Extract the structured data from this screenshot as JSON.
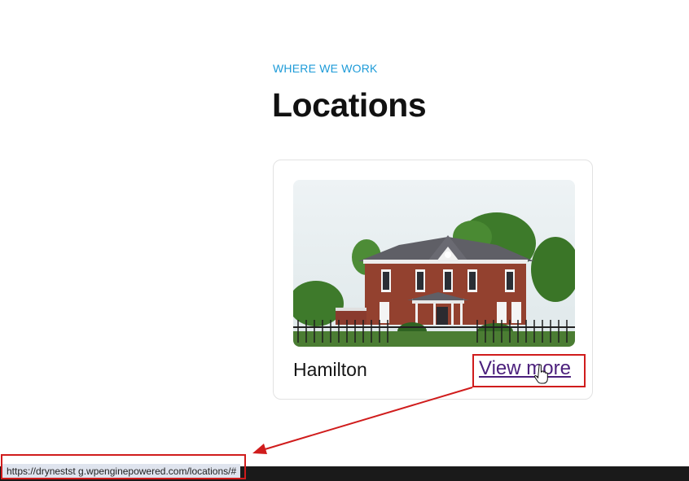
{
  "section": {
    "eyebrow": "WHERE WE WORK",
    "title": "Locations"
  },
  "card": {
    "name": "Hamilton",
    "link_label": "View more",
    "image_subject": "brick-victorian-house"
  },
  "status_bar": {
    "url": "https://drynestst g.wpenginepowered.com/locations/#"
  },
  "colors": {
    "eyebrow": "#1d9bd8",
    "link_visited": "#4b1f7c",
    "annotation_red": "#d01c1c",
    "status_bg": "#1a1a1a"
  }
}
